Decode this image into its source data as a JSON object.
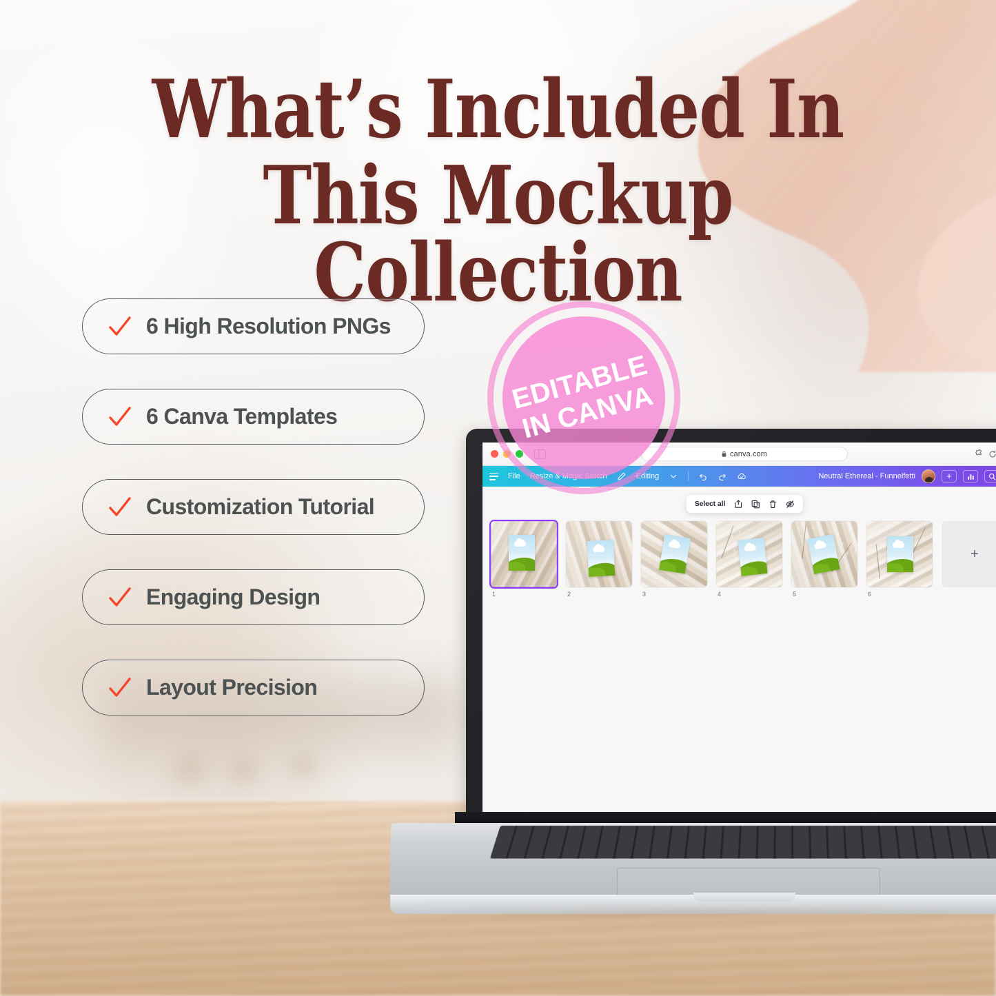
{
  "page": {
    "headline_line1": "What’s Included In",
    "headline_line2": "This Mockup Collection",
    "accent_maroon": "#6B2A23",
    "check_red": "#F5462C",
    "pill_text_color": "#4C5251",
    "badge_pink": "#F786D4"
  },
  "checklist": {
    "items": [
      {
        "label": "6 High Resolution PNGs",
        "icon": "check-icon"
      },
      {
        "label": "6 Canva Templates",
        "icon": "check-icon"
      },
      {
        "label": "Customization Tutorial",
        "icon": "check-icon"
      },
      {
        "label": "Engaging Design",
        "icon": "check-icon"
      },
      {
        "label": "Layout Precision",
        "icon": "check-icon"
      }
    ]
  },
  "badge": {
    "line1": "EDITABLE",
    "line2": "IN CANVA"
  },
  "browser": {
    "url": "canva.com",
    "lock_icon": "lock-icon",
    "extensions_icon": "puzzle-icon",
    "reload_icon": "reload-icon",
    "sidebar_icon": "sidebar-toggle-icon",
    "traffic_lights": [
      "close",
      "minimize",
      "zoom"
    ]
  },
  "canva": {
    "menu": [
      {
        "label": "File",
        "icon": ""
      },
      {
        "label": "Resize & Magic Switch",
        "icon": "magic-switch-icon"
      },
      {
        "label": "Editing",
        "icon": "pencil-icon"
      }
    ],
    "toolbar_icons": [
      "undo-icon",
      "redo-icon",
      "cloud-saved-icon"
    ],
    "document_title": "Neutral Ethereal - Funnelfetti",
    "avatar": "user-avatar",
    "right_actions": [
      "plus-icon",
      "insights-icon",
      "search-icon"
    ],
    "gradient_start": "#1EC6DC",
    "gradient_end": "#7A4FE8",
    "floating_toolbar": {
      "select_all_label": "Select all",
      "icons": [
        "add-page-icon",
        "duplicate-icon",
        "delete-icon",
        "hide-page-icon"
      ]
    },
    "pages": [
      {
        "number": "1",
        "selected": true
      },
      {
        "number": "2",
        "selected": false
      },
      {
        "number": "3",
        "selected": false
      },
      {
        "number": "4",
        "selected": false
      },
      {
        "number": "5",
        "selected": false
      },
      {
        "number": "6",
        "selected": false
      }
    ],
    "add_page_label": "+",
    "selection_color": "#8B3DFF"
  }
}
